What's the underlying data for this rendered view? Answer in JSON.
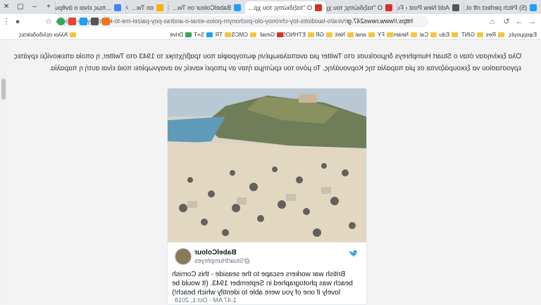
{
  "tabs": [
    {
      "title": "(5) Pitch perfect nft ol...",
      "color": "#1da1f2"
    },
    {
      "title": "Add New Post ‹ Futuri...",
      "color": "#555555"
    },
    {
      "title": "O \"ταξιδιώτης του χρ...",
      "color": "#d93025"
    },
    {
      "title": "O \"ταξιδιώτης του χρ...",
      "color": "#d93025"
    },
    {
      "title": "BabelColour on Tw...",
      "color": "#1da1f2"
    },
    {
      "title": "on Tw...",
      "color": "#f4b400"
    },
    {
      "title": "...πως είναι ο άνθρωπ...",
      "color": "#4285f4"
    }
  ],
  "address": {
    "secure": "https://www.news247.gr",
    "path": "/viral/o-taxidiotis-toy-chronoy-olo-pschonym-poios-einai-o-andras-poy-paizei-me-to-kinito-toy-se-fotografia-t..."
  },
  "bookmarks": [
    "Εφαρμογές",
    "Res",
    "GINT",
    "Edu",
    "Cal",
    "Neam",
    "FY",
    "anal",
    "Neit",
    "GR",
    "ETHNOS",
    "Gmail",
    "CMCS",
    "TR",
    "S+T",
    "Drive",
    "Άλλοι σελιδοδείκτες"
  ],
  "article": {
    "line1": "Όλα ξεκίνησαν όταν ο Stuart Humphreys δημοσίευσε στο Twitter μια αναπαλαιωμένη φωτογραφία που τραβήχτηκε το 1943 στο Twitter, η οποία απεικονίζει εργάτες",
    "line2": "εργοστασίου να ξεκουράζονται σε μία παραλία της Κορνουάλης. Το μόνο του ερώτημα ήταν αν μπορεί κανείς να αναγνωρίσει ποιά είναι αυτή η παραλία."
  },
  "tweet": {
    "name": "BabelColour",
    "handle": "@StuartHumphryes",
    "text": "British war workers escape to the seaside - this Cornish beach was photographed in September 1943. (It would be lovely if one of you were able to identify which beach!)",
    "date": "1:47 AM - Oct 1, 2018"
  }
}
